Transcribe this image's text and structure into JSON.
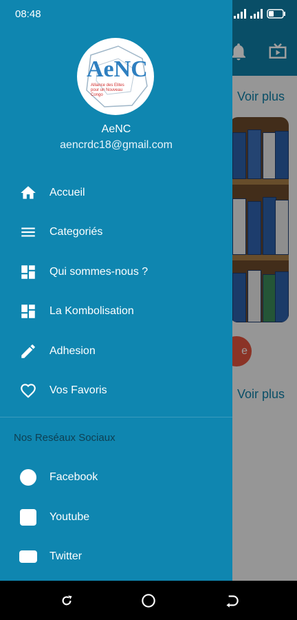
{
  "status_bar": {
    "time": "08:48"
  },
  "background": {
    "voir_plus_1": "Voir plus",
    "voir_plus_2": "Voir plus",
    "button_fragment": "e"
  },
  "drawer": {
    "logo_text": "AeNC",
    "name": "AeNC",
    "email": "aencrdc18@gmail.com",
    "menu": [
      {
        "label": "Accueil",
        "icon": "home-icon"
      },
      {
        "label": "Categoriés",
        "icon": "menu-icon"
      },
      {
        "label": "Qui sommes-nous ?",
        "icon": "dashboard-icon"
      },
      {
        "label": "La Kombolisation",
        "icon": "dashboard-icon"
      },
      {
        "label": "Adhesion",
        "icon": "pencil-icon"
      },
      {
        "label": "Vos Favoris",
        "icon": "heart-icon"
      }
    ],
    "social_title": "Nos Reséaux Sociaux",
    "social": [
      {
        "label": "Facebook",
        "icon": "facebook-icon"
      },
      {
        "label": "Youtube",
        "icon": "youtube-icon"
      },
      {
        "label": "Twitter",
        "icon": "twitter-icon"
      }
    ]
  },
  "colors": {
    "drawer_bg": "#0f86b0",
    "header_bg": "#0f7fa6",
    "text": "#ffffff"
  }
}
